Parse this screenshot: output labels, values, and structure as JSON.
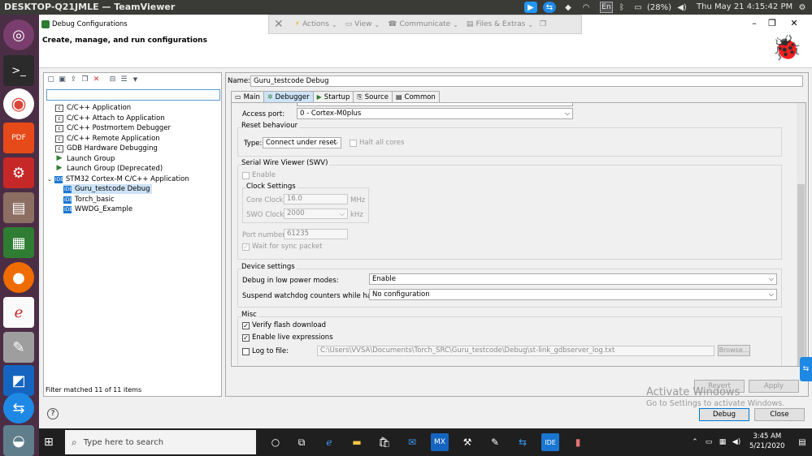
{
  "topbar": {
    "title": "DESKTOP-Q21JMLE — TeamViewer",
    "language": "En",
    "battery": "(28%)",
    "datetime": "Thu May 21  4:15:42 PM"
  },
  "teamviewer_toolbar": {
    "actions": "Actions",
    "view": "View",
    "communicate": "Communicate",
    "files_extras": "Files & Extras"
  },
  "dialog": {
    "title": "Debug Configurations",
    "header": "Create, manage, and run configurations"
  },
  "left": {
    "tree": [
      {
        "label": "C/C++ Application",
        "icon": "c-icon"
      },
      {
        "label": "C/C++ Attach to Application",
        "icon": "c-icon"
      },
      {
        "label": "C/C++ Postmortem Debugger",
        "icon": "c-icon"
      },
      {
        "label": "C/C++ Remote Application",
        "icon": "c-icon"
      },
      {
        "label": "GDB Hardware Debugging",
        "icon": "c-icon"
      },
      {
        "label": "Launch Group",
        "icon": "launch-icon"
      },
      {
        "label": "Launch Group (Deprecated)",
        "icon": "launch-icon"
      },
      {
        "label": "STM32 Cortex-M C/C++ Application",
        "icon": "stm32-icon"
      },
      {
        "label": "Guru_testcode Debug",
        "icon": "ide-icon"
      },
      {
        "label": "Torch_basic",
        "icon": "ide-icon"
      },
      {
        "label": "WWDG_Example",
        "icon": "ide-icon"
      }
    ],
    "status": "Filter matched 11 of 11 items"
  },
  "right": {
    "name_label": "Name:",
    "name_value": "Guru_testcode Debug",
    "tabs": [
      "Main",
      "Debugger",
      "Startup",
      "Source",
      "Common"
    ],
    "access_port_label": "Access port:",
    "access_port_value": "0 - Cortex-M0plus",
    "reset": {
      "title": "Reset behaviour",
      "type_label": "Type:",
      "type_value": "Connect under reset",
      "halt_all": "Halt all cores"
    },
    "swv": {
      "title": "Serial Wire Viewer (SWV)",
      "enable": "Enable",
      "clock_title": "Clock Settings",
      "core_clock_label": "Core Clock:",
      "core_clock_value": "16.0",
      "core_clock_unit": "MHz",
      "swo_clock_label": "SWO Clock:",
      "swo_clock_value": "2000",
      "swo_clock_unit": "kHz",
      "port_label": "Port number:",
      "port_value": "61235",
      "wait_sync": "Wait for sync packet"
    },
    "device": {
      "title": "Device settings",
      "low_power_label": "Debug in low power modes:",
      "low_power_value": "Enable",
      "watchdog_label": "Suspend watchdog counters while halted:",
      "watchdog_value": "No configuration"
    },
    "misc": {
      "title": "Misc",
      "verify_flash": "Verify flash download",
      "live_expr": "Enable live expressions",
      "log_to_file": "Log to file:",
      "log_path": "C:\\Users\\VVSA\\Documents\\Torch_SRC\\Guru_testcode\\Debug\\st-link_gdbserver_log.txt",
      "browse": "Browse..."
    },
    "revert": "Revert",
    "apply": "Apply"
  },
  "footer": {
    "debug": "Debug",
    "close": "Close"
  },
  "watermark": {
    "line1": "Activate Windows",
    "line2": "Go to Settings to activate Windows."
  },
  "taskbar": {
    "search_placeholder": "Type here to search",
    "time": "3:45 AM",
    "date": "5/21/2020",
    "mx_label": "MX",
    "ide_label": "IDE"
  }
}
